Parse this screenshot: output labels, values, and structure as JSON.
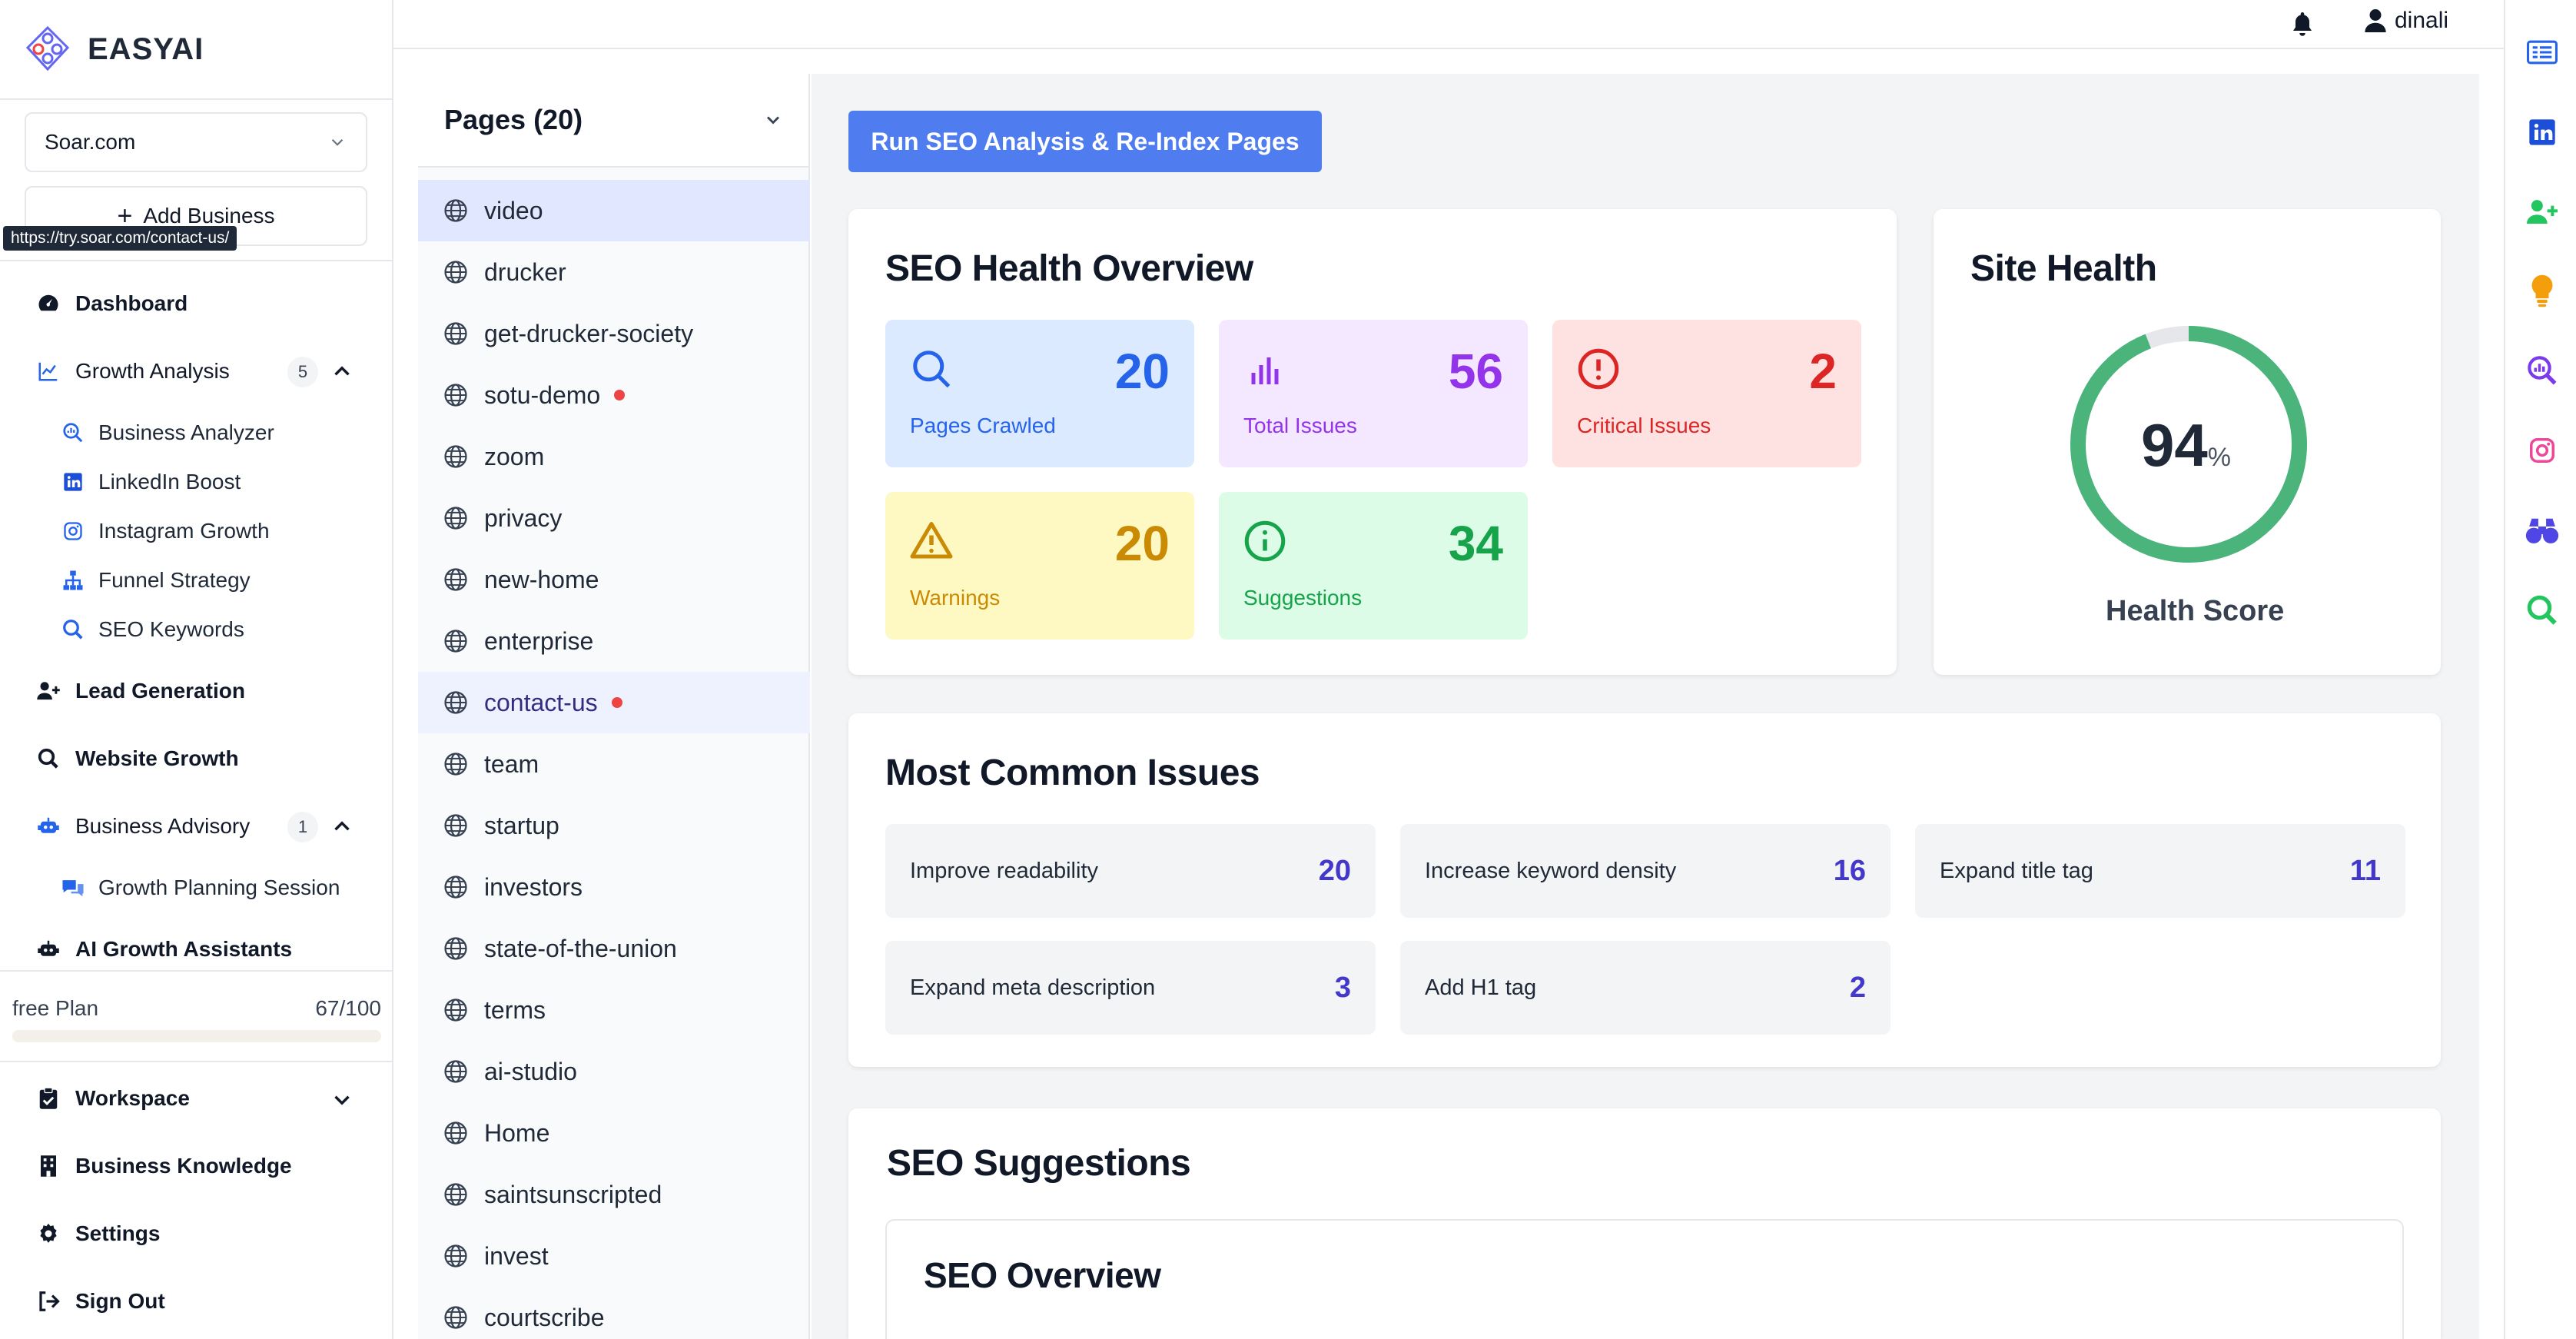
{
  "brand": {
    "name": "EASYAI"
  },
  "sidebar": {
    "business_select": "Soar.com",
    "add_business": "Add Business",
    "tooltip": "https://try.soar.com/contact-us/",
    "dashboard": "Dashboard",
    "growth_analysis": {
      "label": "Growth Analysis",
      "badge": "5"
    },
    "growth_items": [
      "Business Analyzer",
      "LinkedIn Boost",
      "Instagram Growth",
      "Funnel Strategy",
      "SEO Keywords"
    ],
    "lead_generation": "Lead Generation",
    "website_growth": "Website Growth",
    "business_advisory": {
      "label": "Business Advisory",
      "badge": "1"
    },
    "advisory_items": [
      "Growth Planning Session"
    ],
    "ai_assistants": "AI Growth Assistants",
    "plan": {
      "name": "free Plan",
      "usage": "67/100",
      "fraction": 0.67
    },
    "workspace": "Workspace",
    "business_knowledge": "Business Knowledge",
    "settings": "Settings",
    "sign_out": "Sign Out"
  },
  "topbar": {
    "user": "dinali"
  },
  "pages": {
    "title": "Pages (20)",
    "items": [
      {
        "name": "video",
        "issue": false
      },
      {
        "name": "drucker",
        "issue": false
      },
      {
        "name": "get-drucker-society",
        "issue": false
      },
      {
        "name": "sotu-demo",
        "issue": true
      },
      {
        "name": "zoom",
        "issue": false
      },
      {
        "name": "privacy",
        "issue": false
      },
      {
        "name": "new-home",
        "issue": false
      },
      {
        "name": "enterprise",
        "issue": false
      },
      {
        "name": "contact-us",
        "issue": true
      },
      {
        "name": "team",
        "issue": false
      },
      {
        "name": "startup",
        "issue": false
      },
      {
        "name": "investors",
        "issue": false
      },
      {
        "name": "state-of-the-union",
        "issue": false
      },
      {
        "name": "terms",
        "issue": false
      },
      {
        "name": "ai-studio",
        "issue": false
      },
      {
        "name": "Home",
        "issue": false
      },
      {
        "name": "saintsunscripted",
        "issue": false
      },
      {
        "name": "invest",
        "issue": false
      },
      {
        "name": "courtscribe",
        "issue": false
      }
    ]
  },
  "run_button": "Run SEO Analysis & Re-Index Pages",
  "overview": {
    "title": "SEO Health Overview",
    "stats": [
      {
        "label": "Pages Crawled",
        "value": "20",
        "icon": "search-icon"
      },
      {
        "label": "Total Issues",
        "value": "56",
        "icon": "bar-chart-icon"
      },
      {
        "label": "Critical Issues",
        "value": "2",
        "icon": "alert-circle-icon"
      },
      {
        "label": "Warnings",
        "value": "20",
        "icon": "warning-triangle-icon"
      },
      {
        "label": "Suggestions",
        "value": "34",
        "icon": "info-circle-icon"
      }
    ],
    "colors": {
      "blue": "#dbeafe",
      "purple": "#f3e8ff",
      "red": "#fee2e2",
      "yellow": "#fef9c3",
      "green": "#dcfce7"
    }
  },
  "site_health": {
    "title": "Site Health",
    "score": "94",
    "unit": "%",
    "fraction": 0.94,
    "label": "Health Score",
    "color": "#4ab47a"
  },
  "common_issues": {
    "title": "Most Common Issues",
    "items": [
      {
        "label": "Improve readability",
        "count": "20"
      },
      {
        "label": "Increase keyword density",
        "count": "16"
      },
      {
        "label": "Expand title tag",
        "count": "11"
      },
      {
        "label": "Expand meta description",
        "count": "3"
      },
      {
        "label": "Add H1 tag",
        "count": "2"
      }
    ]
  },
  "suggestions": {
    "title": "SEO Suggestions",
    "overview_title": "SEO Overview"
  }
}
